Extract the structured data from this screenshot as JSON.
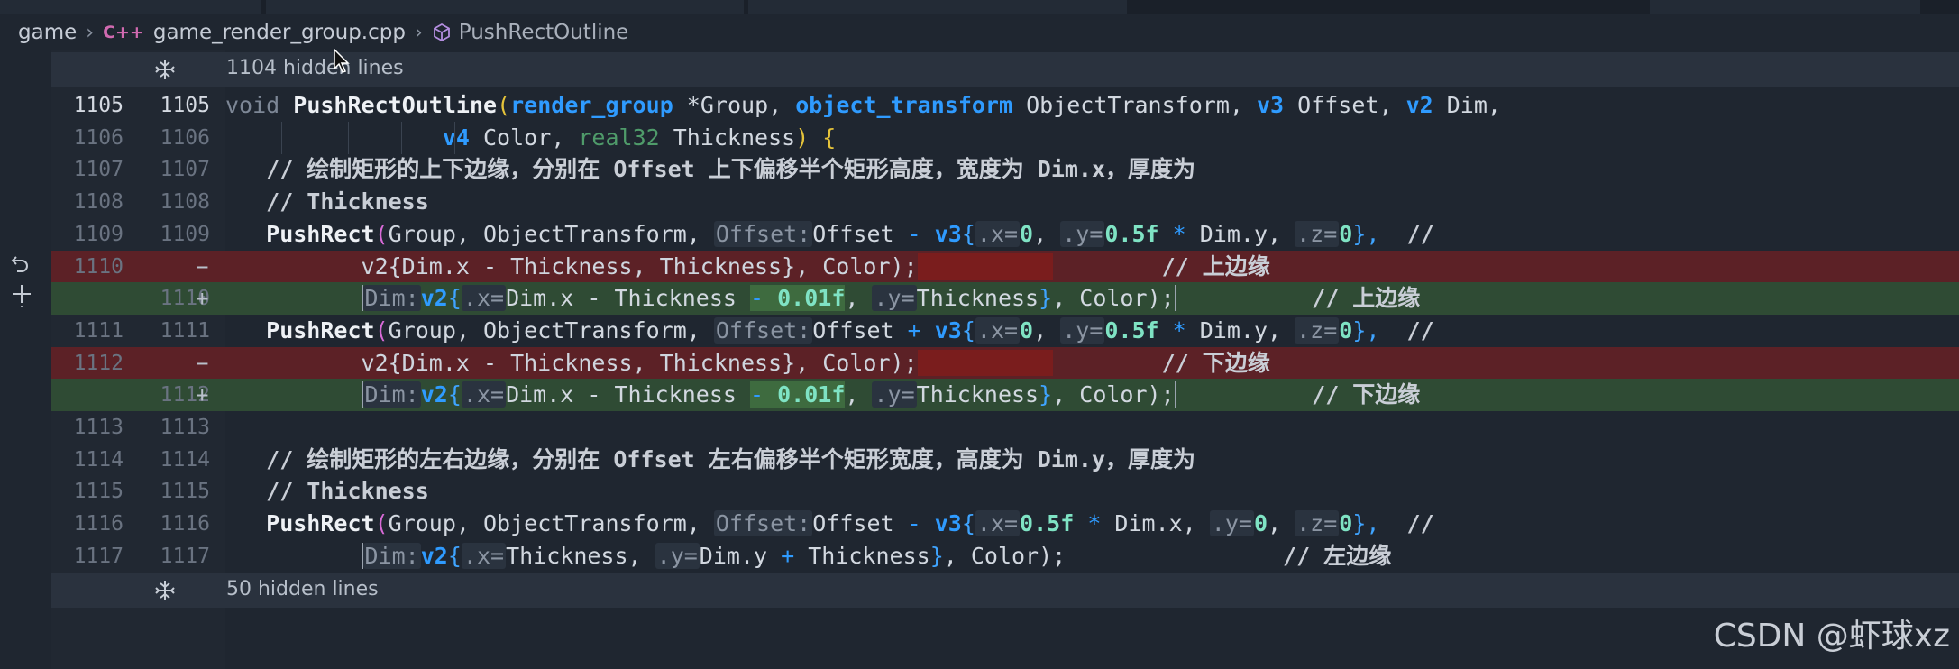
{
  "breadcrumb": {
    "folder": "game",
    "lang_badge": "C++",
    "file": "game_render_group.cpp",
    "symbol": "PushRectOutline"
  },
  "hidden_top": {
    "text": "1104 hidden lines"
  },
  "hidden_bottom": {
    "text": "50 hidden lines"
  },
  "colors": {
    "deleted_line": "#5c2126",
    "added_line": "#2f4b34",
    "keyword_type": "#2f9bff",
    "number": "#7fe3c4"
  },
  "icons": {
    "unfold": "unfold-icon",
    "revert": "undo-icon",
    "stage": "plus-icon",
    "cpp": "cpp-file-icon",
    "symbol": "cube-icon",
    "chevron": "chevron-right-icon"
  },
  "lines": [
    {
      "old": "1105",
      "new": "1105",
      "mark": ""
    },
    {
      "old": "1106",
      "new": "1106",
      "mark": ""
    },
    {
      "old": "1107",
      "new": "1107",
      "mark": ""
    },
    {
      "old": "1108",
      "new": "1108",
      "mark": ""
    },
    {
      "old": "1109",
      "new": "1109",
      "mark": ""
    },
    {
      "old": "1110",
      "new": "",
      "mark": "−"
    },
    {
      "old": "",
      "new": "1110",
      "mark": "+"
    },
    {
      "old": "1111",
      "new": "1111",
      "mark": ""
    },
    {
      "old": "1112",
      "new": "",
      "mark": "−"
    },
    {
      "old": "",
      "new": "1112",
      "mark": "+"
    },
    {
      "old": "1113",
      "new": "1113",
      "mark": ""
    },
    {
      "old": "1114",
      "new": "1114",
      "mark": ""
    },
    {
      "old": "1115",
      "new": "1115",
      "mark": ""
    },
    {
      "old": "1116",
      "new": "1116",
      "mark": ""
    },
    {
      "old": "1117",
      "new": "1117",
      "mark": ""
    }
  ],
  "code": {
    "l1105": {
      "void": "void",
      "name": "PushRectOutline",
      "p1": "(",
      "t1": "render_group",
      "star": " *",
      "a1": "Group, ",
      "t2": "object_transform",
      "a2": " ObjectTransform, ",
      "t3": "v3",
      "a3": " Offset, ",
      "t4": "v2",
      "a4": " Dim,"
    },
    "l1106": {
      "t1": "v4",
      "a1": " Color, ",
      "t2": "real32",
      "a2": " Thickness",
      "p2": ")",
      "ob": " {"
    },
    "l1107": {
      "c": "// 绘制矩形的上下边缘，分别在 Offset 上下偏移半个矩形高度，宽度为 Dim.x，厚度为"
    },
    "l1108": {
      "c": "// Thickness"
    },
    "l1109": {
      "fn": "PushRect",
      "p": "(",
      "a": "Group, ObjectTransform, ",
      "h": "Offset:",
      "b": "Offset ",
      "op": "-",
      "sp": " ",
      "ty": "v3",
      "br": "{",
      "hx": ".x=",
      "n0": "0",
      "cm": ", ",
      "hy": ".y=",
      "n5": "0.5f",
      "mul": " * ",
      "dy": "Dim.y, ",
      "hz": ".z=",
      "nz": "0",
      "cb": "},",
      "cc": "  //"
    },
    "l1110d": {
      "a": "v2{Dim.x - Thickness, Thickness}, Color);",
      "c": "// 上边缘"
    },
    "l1110a": {
      "h": "Dim:",
      "ty": "v2",
      "br": "{",
      "hx": ".x=",
      "a": "Dim.x - Thickness ",
      "op": "-",
      "n": " 0.01f",
      "cm": ", ",
      "hy": ".y=",
      "b": "Thickness",
      "cb": "}",
      "e": ", Color);",
      "c": "// 上边缘"
    },
    "l1111": {
      "fn": "PushRect",
      "p": "(",
      "a": "Group, ObjectTransform, ",
      "h": "Offset:",
      "b": "Offset ",
      "op": "+",
      "sp": " ",
      "ty": "v3",
      "br": "{",
      "hx": ".x=",
      "n0": "0",
      "cm": ", ",
      "hy": ".y=",
      "n5": "0.5f",
      "mul": " * ",
      "dy": "Dim.y, ",
      "hz": ".z=",
      "nz": "0",
      "cb": "},",
      "cc": "  //"
    },
    "l1112d": {
      "a": "v2{Dim.x - Thickness, Thickness}, Color);",
      "c": "// 下边缘"
    },
    "l1112a": {
      "h": "Dim:",
      "ty": "v2",
      "br": "{",
      "hx": ".x=",
      "a": "Dim.x - Thickness ",
      "op": "-",
      "n": " 0.01f",
      "cm": ", ",
      "hy": ".y=",
      "b": "Thickness",
      "cb": "}",
      "e": ", Color);",
      "c": "// 下边缘"
    },
    "l1114": {
      "c": "// 绘制矩形的左右边缘，分别在 Offset 左右偏移半个矩形宽度，高度为 Dim.y，厚度为"
    },
    "l1115": {
      "c": "// Thickness"
    },
    "l1116": {
      "fn": "PushRect",
      "p": "(",
      "a": "Group, ObjectTransform, ",
      "h": "Offset:",
      "b": "Offset ",
      "op": "-",
      "sp": " ",
      "ty": "v3",
      "br": "{",
      "hx": ".x=",
      "n5": "0.5f",
      "mul": " * ",
      "dx": "Dim.x, ",
      "hy": ".y=",
      "n0": "0",
      "cm": ", ",
      "hz": ".z=",
      "nz": "0",
      "cb": "},",
      "cc": "  //"
    },
    "l1117": {
      "h": "Dim:",
      "ty": "v2",
      "br": "{",
      "hx": ".x=",
      "a": "Thickness, ",
      "hy": ".y=",
      "b": "Dim.y ",
      "op": "+",
      "c2": " Thickness",
      "cb": "}",
      "e": ", Color);",
      "c": "// 左边缘"
    }
  },
  "watermark": "CSDN @虾球xz"
}
